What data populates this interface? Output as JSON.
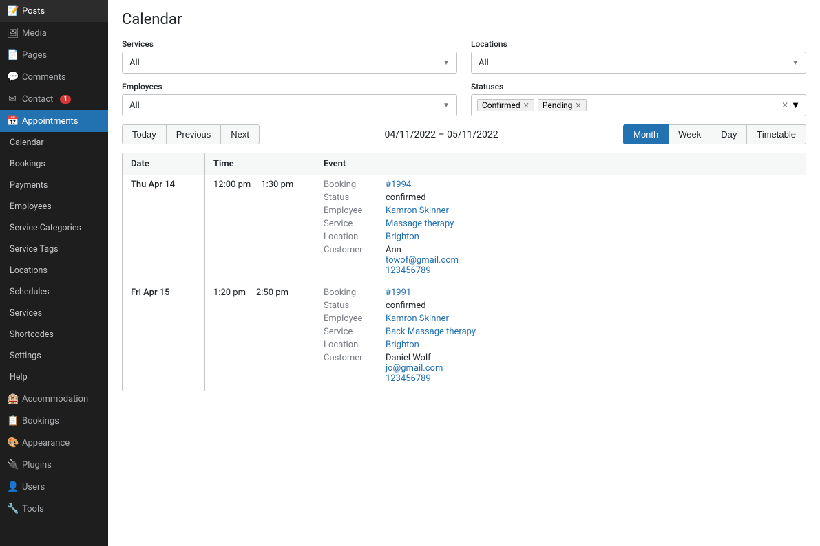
{
  "page_title": "Calendar",
  "sidebar": {
    "items": [
      {
        "id": "posts",
        "label": "Posts",
        "icon": "📝",
        "active": false
      },
      {
        "id": "media",
        "label": "Media",
        "icon": "🖼",
        "active": false
      },
      {
        "id": "pages",
        "label": "Pages",
        "icon": "📄",
        "active": false
      },
      {
        "id": "comments",
        "label": "Comments",
        "icon": "💬",
        "badge": null,
        "active": false
      },
      {
        "id": "contact",
        "label": "Contact",
        "icon": "✉",
        "badge": "1",
        "active": false
      },
      {
        "id": "appointments",
        "label": "Appointments",
        "icon": "📅",
        "active": true
      },
      {
        "id": "calendar",
        "label": "Calendar",
        "sub": true,
        "active": false
      },
      {
        "id": "bookings",
        "label": "Bookings",
        "sub": true,
        "active": false
      },
      {
        "id": "payments",
        "label": "Payments",
        "sub": true,
        "active": false
      },
      {
        "id": "employees",
        "label": "Employees",
        "sub": true,
        "active": false
      },
      {
        "id": "service-categories",
        "label": "Service Categories",
        "sub": true,
        "active": false
      },
      {
        "id": "service-tags",
        "label": "Service Tags",
        "sub": true,
        "active": false
      },
      {
        "id": "locations",
        "label": "Locations",
        "sub": true,
        "active": false
      },
      {
        "id": "schedules",
        "label": "Schedules",
        "sub": true,
        "active": false
      },
      {
        "id": "services",
        "label": "Services",
        "sub": true,
        "active": false
      },
      {
        "id": "shortcodes",
        "label": "Shortcodes",
        "sub": true,
        "active": false
      },
      {
        "id": "settings",
        "label": "Settings",
        "sub": true,
        "active": false
      },
      {
        "id": "help",
        "label": "Help",
        "sub": true,
        "active": false
      },
      {
        "id": "accommodation",
        "label": "Accommodation",
        "icon": "🏨",
        "active": false
      },
      {
        "id": "bookings2",
        "label": "Bookings",
        "icon": "📋",
        "active": false
      },
      {
        "id": "appearance",
        "label": "Appearance",
        "icon": "🎨",
        "active": false
      },
      {
        "id": "plugins",
        "label": "Plugins",
        "icon": "🔌",
        "active": false
      },
      {
        "id": "users",
        "label": "Users",
        "icon": "👤",
        "active": false
      },
      {
        "id": "tools",
        "label": "Tools",
        "icon": "🔧",
        "active": false
      }
    ]
  },
  "filters": {
    "services_label": "Services",
    "services_value": "All",
    "locations_label": "Locations",
    "locations_value": "All",
    "employees_label": "Employees",
    "employees_value": "All",
    "statuses_label": "Statuses",
    "status_tags": [
      {
        "label": "Confirmed"
      },
      {
        "label": "Pending"
      }
    ]
  },
  "nav": {
    "today": "Today",
    "previous": "Previous",
    "next": "Next",
    "date_range": "04/11/2022 – 05/11/2022",
    "views": [
      {
        "label": "Month",
        "active": true
      },
      {
        "label": "Week",
        "active": false
      },
      {
        "label": "Day",
        "active": false
      },
      {
        "label": "Timetable",
        "active": false
      }
    ]
  },
  "table": {
    "headers": [
      "Date",
      "Time",
      "Event"
    ],
    "rows": [
      {
        "date": "Thu Apr 14",
        "time": "12:00 pm – 1:30 pm",
        "booking_label": "Booking",
        "booking_id": "#1994",
        "status_label": "Status",
        "status_value": "confirmed",
        "employee_label": "Employee",
        "employee_name": "Kamron Skinner",
        "service_label": "Service",
        "service_name": "Massage therapy",
        "location_label": "Location",
        "location_name": "Brighton",
        "customer_label": "Customer",
        "customer_name": "Ann",
        "customer_email": "towof@gmail.com",
        "customer_phone": "123456789"
      },
      {
        "date": "Fri Apr 15",
        "time": "1:20 pm – 2:50 pm",
        "booking_label": "Booking",
        "booking_id": "#1991",
        "status_label": "Status",
        "status_value": "confirmed",
        "employee_label": "Employee",
        "employee_name": "Kamron Skinner",
        "service_label": "Service",
        "service_name": "Back Massage therapy",
        "location_label": "Location",
        "location_name": "Brighton",
        "customer_label": "Customer",
        "customer_name": "Daniel Wolf",
        "customer_email": "jo@gmail.com",
        "customer_phone": "123456789"
      }
    ]
  }
}
